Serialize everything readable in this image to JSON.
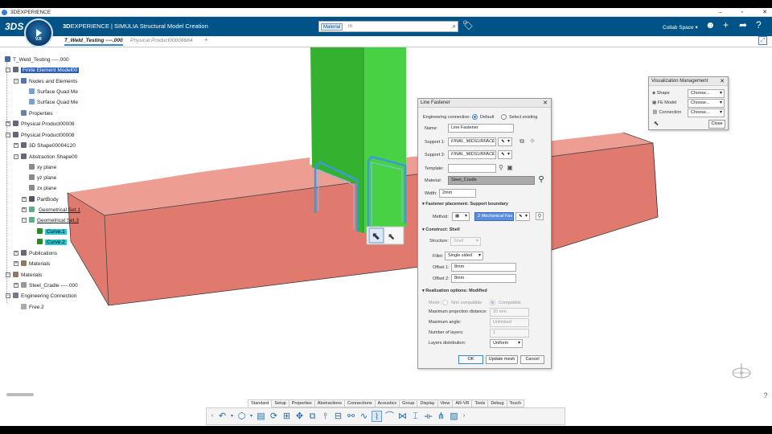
{
  "window": {
    "title": "3DEXPERIENCE"
  },
  "app": {
    "title_bold": "3D",
    "title_rest": "EXPERIENCE | SIMULIA Structural Model Creation",
    "compass_version": "V.R",
    "collab_space": "Collab Space ▾"
  },
  "search": {
    "category": "Material",
    "placeholder": "In"
  },
  "tabs": [
    {
      "label": "T_Weld_Testing ----.000"
    },
    {
      "label": "Physical Product00008684"
    },
    {
      "label": "+"
    }
  ],
  "tree": [
    {
      "label": "T_Weld_Testing ----.000"
    },
    {
      "label": "Finite Element Model00"
    },
    {
      "label": "Nodes and Elements"
    },
    {
      "label": "Surface Quad Me"
    },
    {
      "label": "Surface Quad Me"
    },
    {
      "label": "Properties"
    },
    {
      "label": "Physical Product00008"
    },
    {
      "label": "Physical Product00008"
    },
    {
      "label": "3D Shape00004120"
    },
    {
      "label": "Abstraction Shape00"
    },
    {
      "label": "xy plane"
    },
    {
      "label": "yz plane"
    },
    {
      "label": "zx plane"
    },
    {
      "label": "PartBody"
    },
    {
      "label": "Geometrical Set.1"
    },
    {
      "label": "Geometrical Set.3"
    },
    {
      "label": "Curve.1"
    },
    {
      "label": "Curve.2"
    },
    {
      "label": "Publications"
    },
    {
      "label": "Materials"
    },
    {
      "label": "Materials"
    },
    {
      "label": "Steel_Cradle ----.000"
    },
    {
      "label": "Engineering Connection"
    },
    {
      "label": "Free.2"
    }
  ],
  "viz": {
    "title": "Visualization Management",
    "rows": [
      {
        "label": "Shape",
        "value": "Choose..."
      },
      {
        "label": "FE Model",
        "value": "Choose..."
      },
      {
        "label": "Connection",
        "value": "Choose..."
      }
    ],
    "close": "Close"
  },
  "fastener": {
    "title": "Line Fastener",
    "eng_conn_label": "Engineering connection:",
    "opt_default": "Default",
    "opt_select": "Select existing",
    "name_label": "Name:",
    "name_value": "Line Fastener",
    "support1_label": "Support 1:",
    "support1_value": "FINAL_MIDSURFACE",
    "support2_label": "Support 2:",
    "support2_value": "FINAL_MIDSURFACE",
    "template_label": "Template:",
    "material_label": "Material:",
    "material_value": "Steel_Cradle",
    "width_label": "Width:",
    "width_value": "2mm",
    "placement_section": "Fastener placement: Support boundary",
    "method_label": "Method:",
    "method_value": "2 Mechanical Fas",
    "construct_section": "Construct: Shell",
    "structure_label": "Structure:",
    "structure_value": "Shell",
    "fillet_label": "Fillet:",
    "fillet_value": "Single sided",
    "offset1_label": "Offset 1:",
    "offset1_value": "8mm",
    "offset2_label": "Offset 2:",
    "offset2_value": "8mm",
    "realization_section": "Realization options: Modified",
    "mesh_label": "Mesh:",
    "mesh_noncompat": "Non compatible",
    "mesh_compat": "Compatible",
    "maxproj_label": "Maximum projection distance:",
    "maxproj_value": "10 mm",
    "maxangle_label": "Maximum angle:",
    "maxangle_value": "Unlimited",
    "layers_label": "Number of layers:",
    "layers_value": "1",
    "layerdist_label": "Layers distribution:",
    "layerdist_value": "Uniform",
    "ok": "OK",
    "update": "Update mesh",
    "cancel": "Cancel"
  },
  "bottom_tabs": [
    "Standard",
    "Setup",
    "Properties",
    "Abstractions",
    "Connections",
    "Acoustics",
    "Group",
    "Display",
    "View",
    "AR-VR",
    "Tools",
    "Debug",
    "Touch"
  ],
  "colors": {
    "appbar": "#005386",
    "beam": "#e07a6e",
    "column": "#3ec43a",
    "curve": "#3a9bd8",
    "selection": "#2a5fb8"
  }
}
